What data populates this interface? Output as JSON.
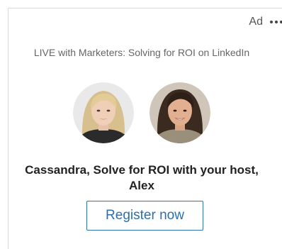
{
  "ad": {
    "label": "Ad",
    "more_icon": "more-options-icon",
    "headline": "LIVE with Marketers: Solving for ROI on LinkedIn",
    "avatars": [
      {
        "name": "avatar-cassandra"
      },
      {
        "name": "avatar-alex"
      }
    ],
    "message": "Cassandra, Solve for ROI with your host, Alex",
    "cta_label": "Register now"
  },
  "colors": {
    "accent": "#2a6fae",
    "border": "#d9d9d9",
    "muted_text": "#666666",
    "primary_text": "#222222"
  }
}
